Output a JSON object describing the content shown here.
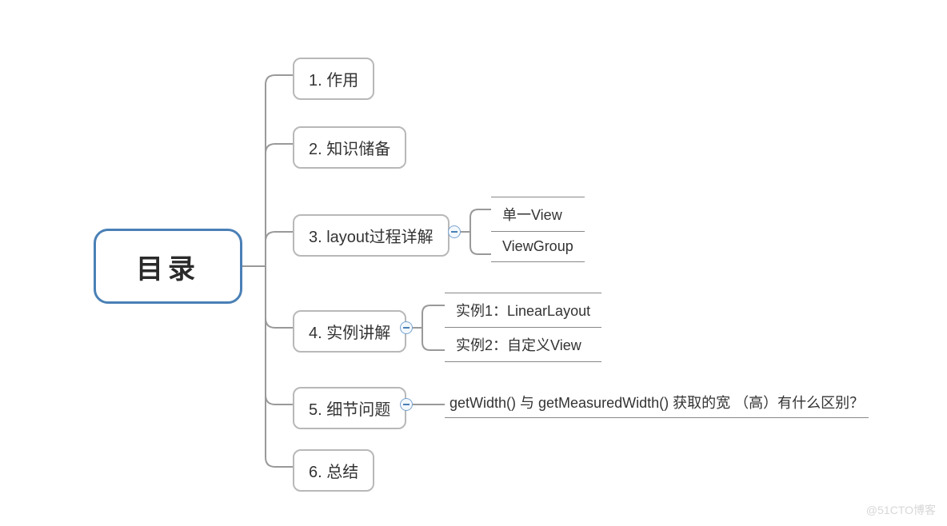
{
  "root": {
    "title": "目录"
  },
  "children": [
    {
      "label": "1. 作用"
    },
    {
      "label": "2. 知识储备"
    },
    {
      "label": "3. layout过程详解",
      "sub": [
        "单一View",
        "ViewGroup"
      ]
    },
    {
      "label": "4. 实例讲解",
      "sub": [
        "实例1：LinearLayout",
        "实例2：自定义View"
      ]
    },
    {
      "label": "5. 细节问题",
      "sub_single": "getWidth() 与 getMeasuredWidth() 获取的宽 （高）有什么区别？"
    },
    {
      "label": "6. 总结"
    }
  ],
  "watermark": "@51CTO博客"
}
